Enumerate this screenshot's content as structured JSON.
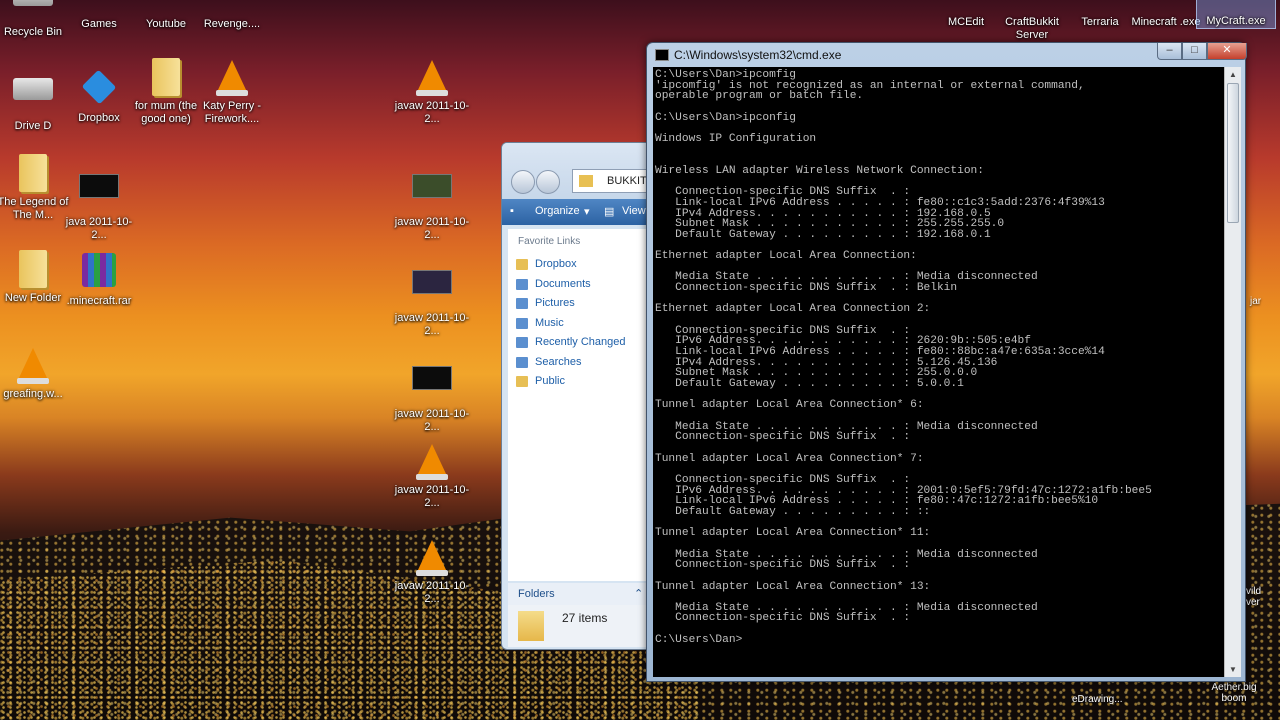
{
  "desktop": {
    "icons": [
      {
        "label": "Recycle Bin"
      },
      {
        "label": "Games"
      },
      {
        "label": "Youtube"
      },
      {
        "label": "Revenge...."
      },
      {
        "label": "Drive D"
      },
      {
        "label": "Dropbox"
      },
      {
        "label": "for mum (the good one)"
      },
      {
        "label": "Katy Perry - Firework...."
      },
      {
        "label": "javaw 2011-10-2..."
      },
      {
        "label": "The Legend of The M..."
      },
      {
        "label": "java 2011-10-2..."
      },
      {
        "label": "javaw 2011-10-2..."
      },
      {
        "label": "New Folder"
      },
      {
        "label": ".minecraft.rar"
      },
      {
        "label": "javaw 2011-10-2..."
      },
      {
        "label": "greafing.w..."
      },
      {
        "label": "javaw 2011-10-2..."
      },
      {
        "label": "javaw 2011-10-2..."
      },
      {
        "label": "javaw 2011-10-2..."
      },
      {
        "label": "MCEdit"
      },
      {
        "label": "CraftBukkit Server"
      },
      {
        "label": "Terraria"
      },
      {
        "label": "Minecraft .exe"
      },
      {
        "label": "MyCraft.exe"
      }
    ],
    "bottom_labels": [
      "eDrawing...",
      "Aether.big boom",
      "jar",
      "vild ver"
    ]
  },
  "explorer": {
    "address": "BUKKIT",
    "organize": "Organize",
    "views": "View",
    "favorites_title": "Favorite Links",
    "favorites": [
      "Dropbox",
      "Documents",
      "Pictures",
      "Music",
      "Recently Changed",
      "Searches",
      "Public"
    ],
    "folders_label": "Folders",
    "status": "27 items"
  },
  "cmd": {
    "title": "C:\\Windows\\system32\\cmd.exe",
    "minimize": "–",
    "maximize": "□",
    "close": "✕",
    "output": "C:\\Users\\Dan>ipcomfig\n'ipcomfig' is not recognized as an internal or external command,\noperable program or batch file.\n\nC:\\Users\\Dan>ipconfig\n\nWindows IP Configuration\n\n\nWireless LAN adapter Wireless Network Connection:\n\n   Connection-specific DNS Suffix  . :\n   Link-local IPv6 Address . . . . . : fe80::c1c3:5add:2376:4f39%13\n   IPv4 Address. . . . . . . . . . . : 192.168.0.5\n   Subnet Mask . . . . . . . . . . . : 255.255.255.0\n   Default Gateway . . . . . . . . . : 192.168.0.1\n\nEthernet adapter Local Area Connection:\n\n   Media State . . . . . . . . . . . : Media disconnected\n   Connection-specific DNS Suffix  . : Belkin\n\nEthernet adapter Local Area Connection 2:\n\n   Connection-specific DNS Suffix  . :\n   IPv6 Address. . . . . . . . . . . : 2620:9b::505:e4bf\n   Link-local IPv6 Address . . . . . : fe80::88bc:a47e:635a:3cce%14\n   IPv4 Address. . . . . . . . . . . : 5.126.45.136\n   Subnet Mask . . . . . . . . . . . : 255.0.0.0\n   Default Gateway . . . . . . . . . : 5.0.0.1\n\nTunnel adapter Local Area Connection* 6:\n\n   Media State . . . . . . . . . . . : Media disconnected\n   Connection-specific DNS Suffix  . :\n\nTunnel adapter Local Area Connection* 7:\n\n   Connection-specific DNS Suffix  . :\n   IPv6 Address. . . . . . . . . . . : 2001:0:5ef5:79fd:47c:1272:a1fb:bee5\n   Link-local IPv6 Address . . . . . : fe80::47c:1272:a1fb:bee5%10\n   Default Gateway . . . . . . . . . : ::\n\nTunnel adapter Local Area Connection* 11:\n\n   Media State . . . . . . . . . . . : Media disconnected\n   Connection-specific DNS Suffix  . :\n\nTunnel adapter Local Area Connection* 13:\n\n   Media State . . . . . . . . . . . : Media disconnected\n   Connection-specific DNS Suffix  . :\n\nC:\\Users\\Dan>"
  }
}
